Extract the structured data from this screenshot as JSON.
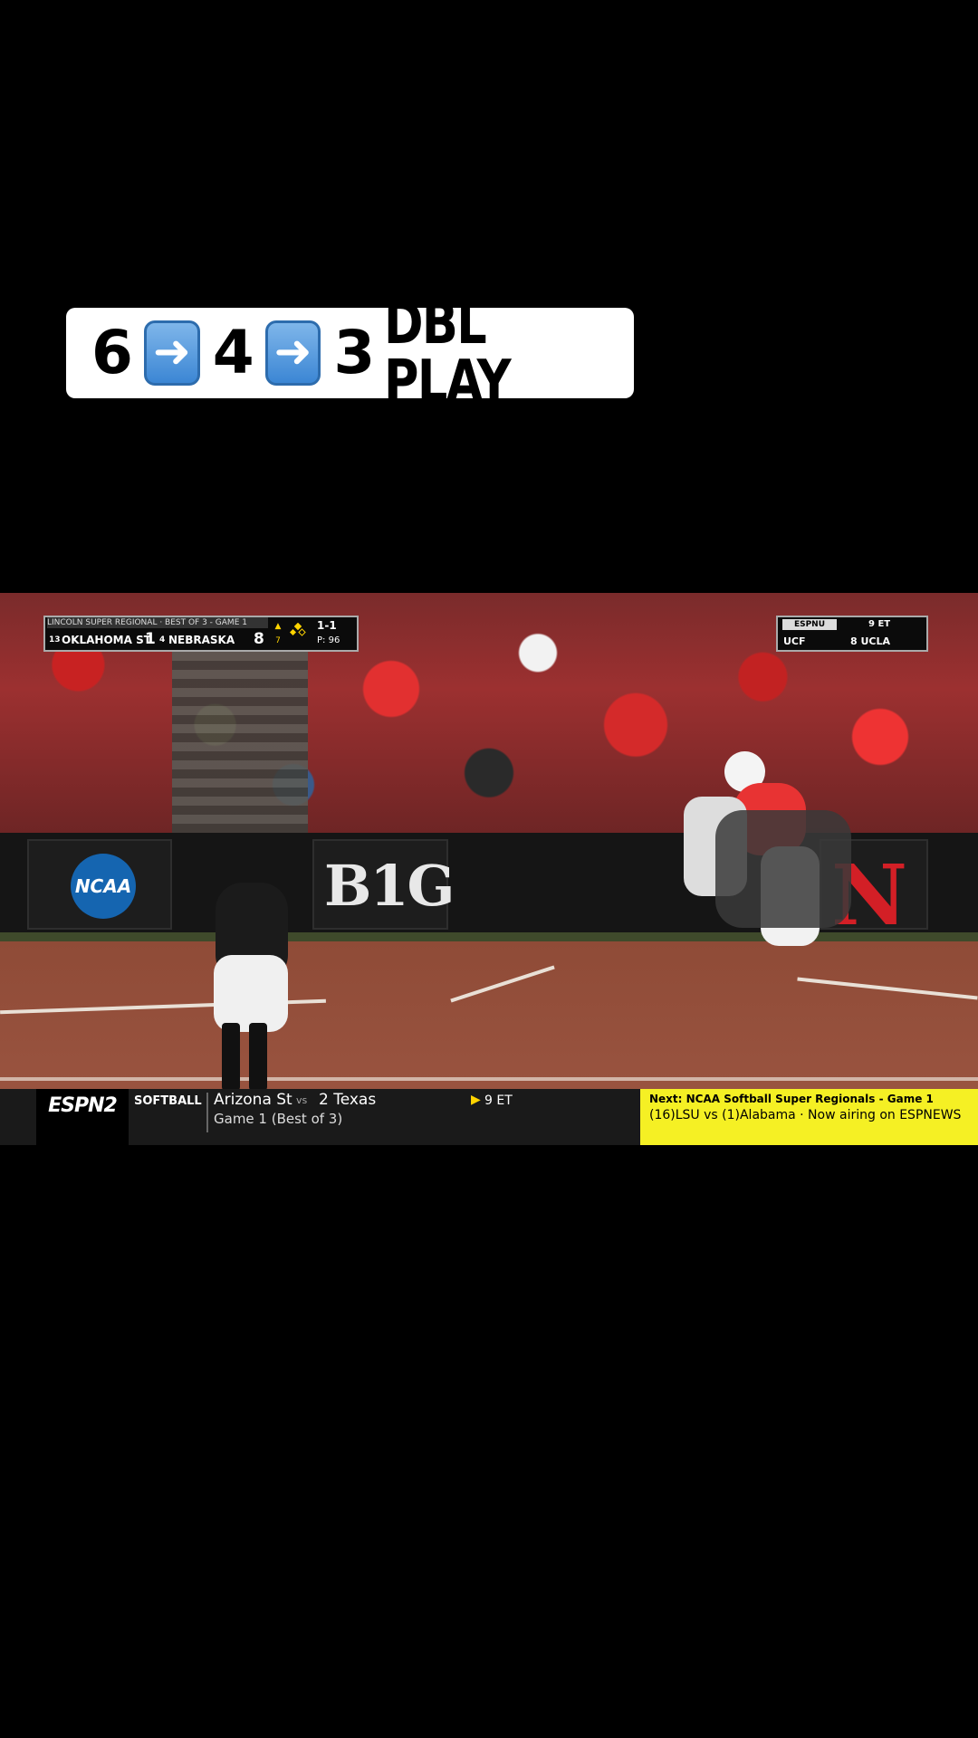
{
  "caption": {
    "num1": "6",
    "num2": "4",
    "num3": "3",
    "text": "DBL PLAY",
    "arrow_icon": "right-arrow-emoji"
  },
  "scorebug": {
    "header": "LINCOLN SUPER REGIONAL · BEST OF 3 - GAME 1",
    "away_rank": "13",
    "away_team": "OKLAHOMA ST",
    "away_score": "1",
    "home_rank": "4",
    "home_team": "NEBRASKA",
    "home_score": "8",
    "inning_top": "▲",
    "inning": "7",
    "count": "1-1",
    "pitch_count": "P: 96"
  },
  "rightbug": {
    "network": "ESPNU",
    "time": "9 ET",
    "team1": "UCF",
    "team2": "8 UCLA"
  },
  "field": {
    "wall_left": "NCAA",
    "wall_center": "B1G",
    "wall_right": "N"
  },
  "ticker": {
    "network_logo": "ESPN2",
    "sport": "SOFTBALL",
    "team1": "Arizona St",
    "vs": "vs",
    "team2": "2 Texas",
    "subline": "Game 1 (Best of 3)",
    "play_icon": "▶",
    "time": "9 ET",
    "next_title": "Next: NCAA Softball Super Regionals - Game 1",
    "next_body": "(16)LSU vs (1)Alabama · Now airing on ESPNEWS"
  },
  "colors": {
    "accent_yellow": "#f5f024",
    "nebraska_red": "#d31f26",
    "ncaa_blue": "#1565b0"
  }
}
